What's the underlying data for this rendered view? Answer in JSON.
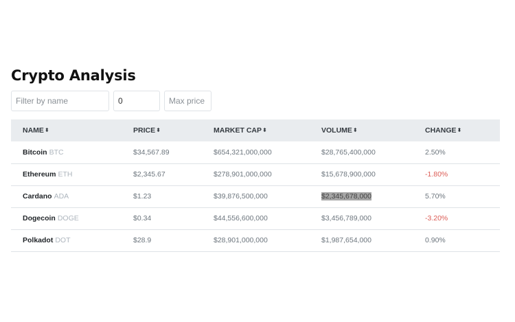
{
  "page": {
    "title": "Crypto Analysis"
  },
  "filters": {
    "name_placeholder": "Filter by name",
    "name_value": "",
    "min_price_value": "0",
    "max_price_placeholder": "Max price",
    "max_price_value": ""
  },
  "table": {
    "columns": [
      {
        "label": "NAME",
        "sort_icon": "sort-icon"
      },
      {
        "label": "PRICE",
        "sort_icon": "sort-icon"
      },
      {
        "label": "MARKET CAP",
        "sort_icon": "sort-icon"
      },
      {
        "label": "VOLUME",
        "sort_icon": "sort-icon"
      },
      {
        "label": "CHANGE",
        "sort_icon": "sort-icon"
      }
    ],
    "sort_glyph": "⬍",
    "rows": [
      {
        "name": "Bitcoin",
        "symbol": "BTC",
        "price": "$34,567.89",
        "market_cap": "$654,321,000,000",
        "volume": "$28,765,400,000",
        "change": "2.50%",
        "direction": "up"
      },
      {
        "name": "Ethereum",
        "symbol": "ETH",
        "price": "$2,345.67",
        "market_cap": "$278,901,000,000",
        "volume": "$15,678,900,000",
        "change": "-1.80%",
        "direction": "down"
      },
      {
        "name": "Cardano",
        "symbol": "ADA",
        "price": "$1.23",
        "market_cap": "$39,876,500,000",
        "volume": "$2,345,678,000",
        "change": "5.70%",
        "direction": "up"
      },
      {
        "name": "Dogecoin",
        "symbol": "DOGE",
        "price": "$0.34",
        "market_cap": "$44,556,600,000",
        "volume": "$3,456,789,000",
        "change": "-3.20%",
        "direction": "down"
      },
      {
        "name": "Polkadot",
        "symbol": "DOT",
        "price": "$28.9",
        "market_cap": "$28,901,000,000",
        "volume": "$1,987,654,000",
        "change": "0.90%",
        "direction": "up"
      }
    ]
  },
  "colors": {
    "header_bg": "#e9ecef",
    "negative": "#dc5b54",
    "positive": "#6c757d",
    "selection_highlight": "#a6a6a6"
  },
  "selection": {
    "row": 2,
    "column": "volume"
  }
}
